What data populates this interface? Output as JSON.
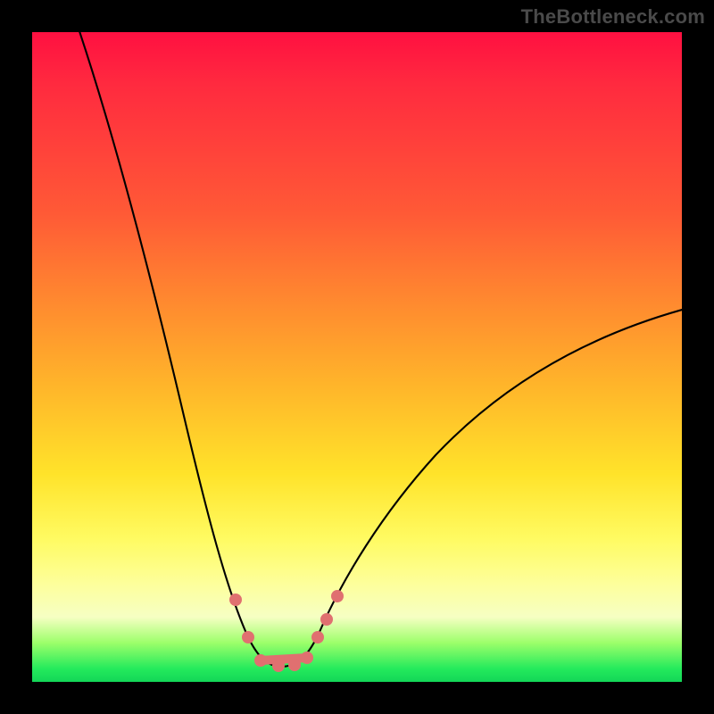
{
  "watermark": "TheBottleneck.com",
  "colors": {
    "page_bg": "#000000",
    "watermark_text": "#4a4a4a",
    "curve_stroke": "#000000",
    "marker_fill": "#e07070",
    "gradient_stops": [
      "#ff1041",
      "#ff2a3f",
      "#ff5a36",
      "#ff8b2f",
      "#ffb72a",
      "#ffe32a",
      "#fffb62",
      "#fdff9c",
      "#f6ffc3",
      "#9cff6a",
      "#24ea5c",
      "#13d657"
    ]
  },
  "chart_data": {
    "type": "line",
    "title": "",
    "xlabel": "",
    "ylabel": "",
    "xlim": [
      0,
      100
    ],
    "ylim": [
      0,
      100
    ],
    "grid": false,
    "legend": false,
    "notes": "V-shaped bottleneck curve. Axes are unlabeled; values are screen-position estimates (x and y as percent of plot area, y measured from bottom). Left branch starts at top-left and descends to a flat minimum near x≈34–42, y≈3; right branch climbs toward upper-right, ending near x≈100, y≈57.",
    "series": [
      {
        "name": "curve",
        "points": [
          {
            "x": 7,
            "y": 100
          },
          {
            "x": 12,
            "y": 86
          },
          {
            "x": 17,
            "y": 68
          },
          {
            "x": 22,
            "y": 49
          },
          {
            "x": 26,
            "y": 32
          },
          {
            "x": 30,
            "y": 17
          },
          {
            "x": 33,
            "y": 7
          },
          {
            "x": 36,
            "y": 3
          },
          {
            "x": 40,
            "y": 2.7
          },
          {
            "x": 43,
            "y": 5
          },
          {
            "x": 47,
            "y": 11
          },
          {
            "x": 53,
            "y": 20
          },
          {
            "x": 60,
            "y": 29
          },
          {
            "x": 70,
            "y": 40
          },
          {
            "x": 80,
            "y": 48
          },
          {
            "x": 90,
            "y": 53
          },
          {
            "x": 100,
            "y": 57
          }
        ]
      }
    ],
    "markers": [
      {
        "x": 31.5,
        "y": 12.5
      },
      {
        "x": 33.5,
        "y": 6.5
      },
      {
        "x": 35.5,
        "y": 3.3
      },
      {
        "x": 38.0,
        "y": 2.8
      },
      {
        "x": 40.5,
        "y": 2.9
      },
      {
        "x": 42.5,
        "y": 4.0
      },
      {
        "x": 44.0,
        "y": 6.8
      },
      {
        "x": 45.5,
        "y": 9.5
      },
      {
        "x": 47.0,
        "y": 13.0
      }
    ],
    "marker_connector": [
      {
        "x": 35.5,
        "y": 3.3
      },
      {
        "x": 42.5,
        "y": 4.0
      }
    ]
  }
}
